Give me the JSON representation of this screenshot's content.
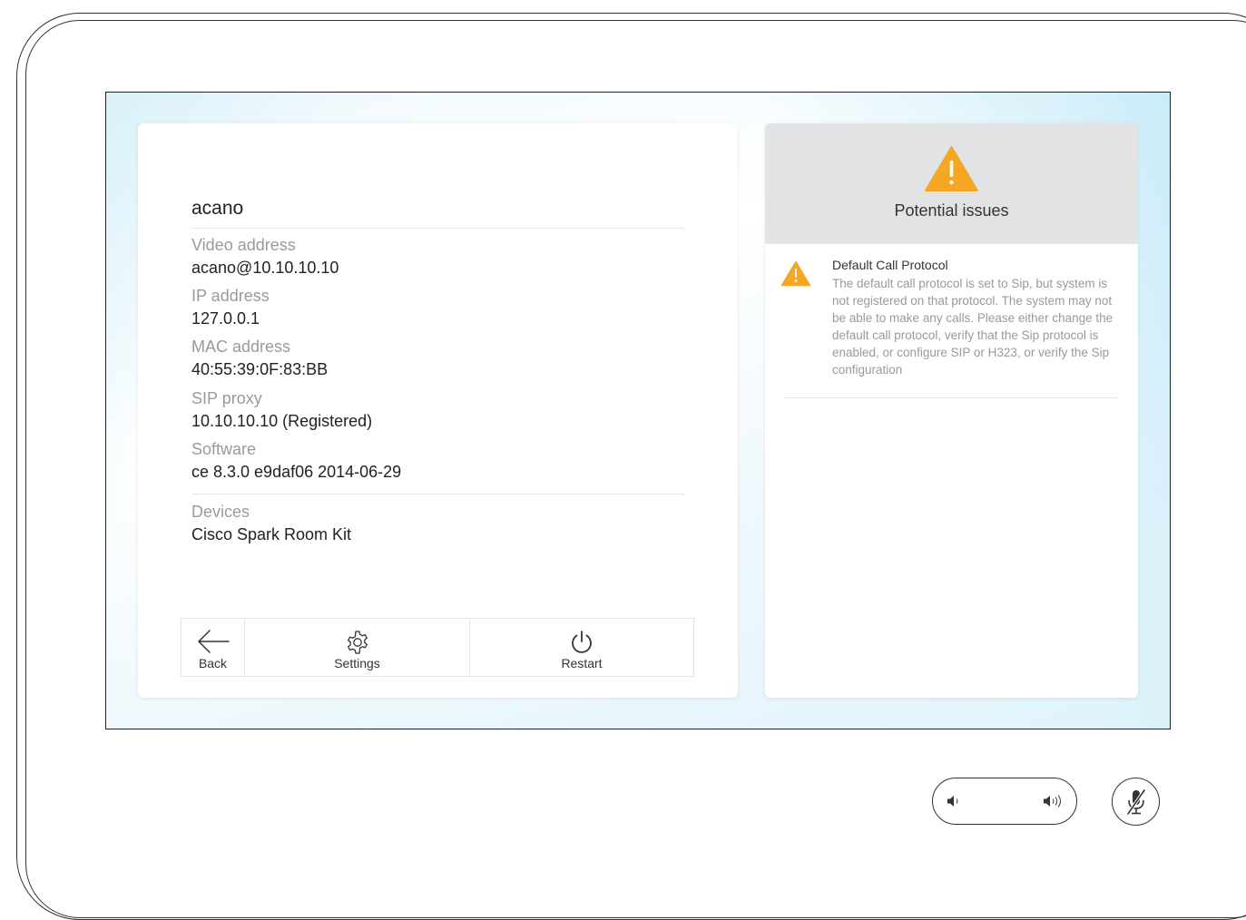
{
  "system": {
    "name": "acano",
    "fields": [
      {
        "label": "Video address",
        "value": "acano@10.10.10.10"
      },
      {
        "label": "IP address",
        "value": "127.0.0.1"
      },
      {
        "label": "MAC address",
        "value": "40:55:39:0F:83:BB"
      },
      {
        "label": "SIP proxy",
        "value": "10.10.10.10 (Registered)"
      },
      {
        "label": "Software",
        "value": "ce 8.3.0 e9daf06 2014-06-29"
      }
    ],
    "devices": {
      "label": "Devices",
      "value": "Cisco Spark Room Kit"
    }
  },
  "toolbar": {
    "back_label": "Back",
    "settings_label": "Settings",
    "restart_label": "Restart"
  },
  "issues": {
    "title": "Potential issues",
    "items": [
      {
        "title": "Default Call Protocol",
        "description": "The default call protocol is set to Sip, but system is not registered on that protocol. The system may not be able to make any calls. Please either change the default call protocol, verify that the Sip protocol is enabled, or configure SIP or H323, or verify the Sip configuration"
      }
    ]
  },
  "colors": {
    "warning": "#f5a623",
    "header_bg": "#e2e3e5",
    "label_gray": "#9a9a9a",
    "text_dark": "#222222"
  },
  "icons": {
    "header_warning": "warning-triangle-icon",
    "issue_warning": "warning-triangle-icon",
    "back": "arrow-left-icon",
    "settings": "gear-icon",
    "restart": "power-icon",
    "volume_down": "speaker-low-icon",
    "volume_up": "speaker-high-icon",
    "mute": "microphone-muted-icon"
  }
}
